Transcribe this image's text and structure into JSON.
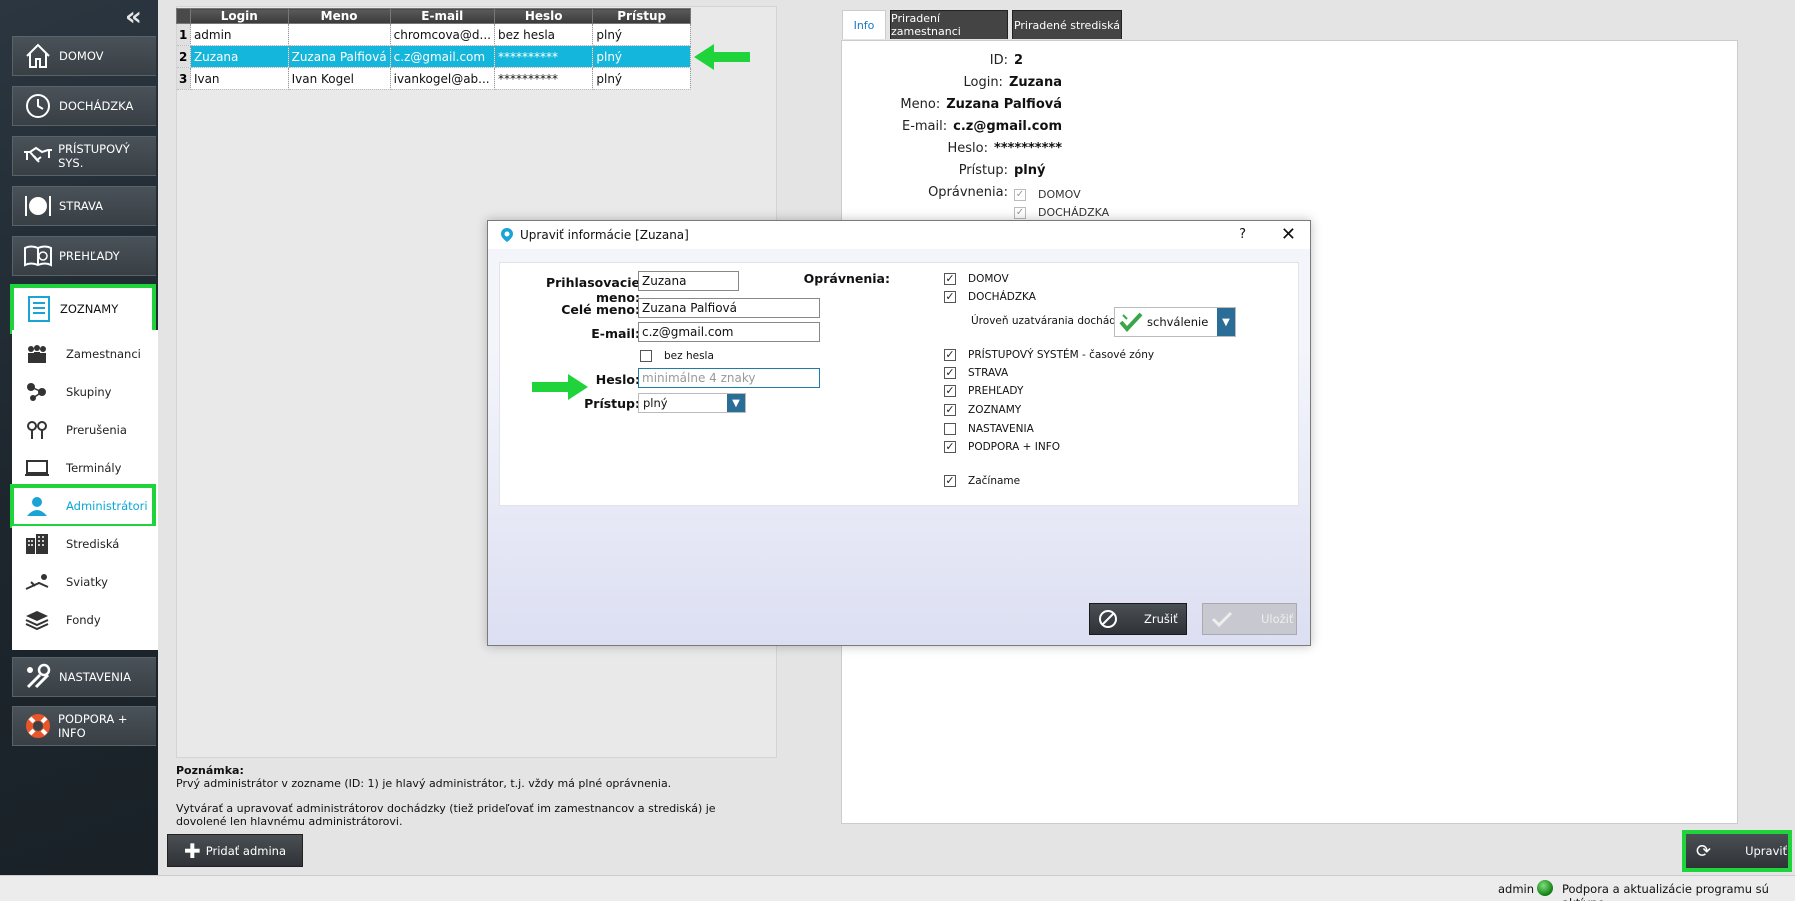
{
  "sidebar": {
    "collapse": "«",
    "main_top": [
      {
        "label": "DOMOV",
        "icon": "home-icon"
      },
      {
        "label": "DOCHÁDZKA",
        "icon": "clock-icon"
      },
      {
        "label": "PRÍSTUPOVÝ SYS.",
        "icon": "handshake-icon"
      },
      {
        "label": "STRAVA",
        "icon": "plate-icon"
      },
      {
        "label": "PREHĽADY",
        "icon": "book-icon"
      },
      {
        "label": "ZOZNAMY",
        "icon": "list-icon"
      }
    ],
    "sub": [
      {
        "label": "Zamestnanci",
        "icon": "people-icon"
      },
      {
        "label": "Skupiny",
        "icon": "groups-icon"
      },
      {
        "label": "Prerušenia",
        "icon": "pins-icon"
      },
      {
        "label": "Terminály",
        "icon": "terminal-icon"
      },
      {
        "label": "Administrátori",
        "icon": "admin-icon"
      },
      {
        "label": "Strediská",
        "icon": "building-icon"
      },
      {
        "label": "Sviatky",
        "icon": "holiday-icon"
      },
      {
        "label": "Fondy",
        "icon": "layers-icon"
      }
    ],
    "main_bottom": [
      {
        "label": "NASTAVENIA",
        "icon": "tools-icon"
      },
      {
        "label": "PODPORA + INFO",
        "icon": "lifebuoy-icon"
      }
    ]
  },
  "grid": {
    "headers": [
      "Login",
      "Meno",
      "E-mail",
      "Heslo",
      "Prístup"
    ],
    "rows": [
      {
        "idx": "1",
        "login": "admin",
        "meno": "",
        "email": "chromcova@d...",
        "heslo": "bez hesla",
        "pristup": "plný"
      },
      {
        "idx": "2",
        "login": "Zuzana",
        "meno": "Zuzana Palfiová",
        "email": "c.z@gmail.com",
        "heslo": "**********",
        "pristup": "plný"
      },
      {
        "idx": "3",
        "login": "Ivan",
        "meno": "Ivan Kogel",
        "email": "ivankogel@ab...",
        "heslo": "**********",
        "pristup": "plný"
      }
    ]
  },
  "note": {
    "title": "Poznámka:",
    "line1": "Prvý administrátor v zozname (ID: 1) je hlavý administrátor, t.j. vždy má plné oprávnenia.",
    "line2": "Vytvárať a upravovať administrátorov dochádzky (tiež prideľovať im zamestnancov a strediská) je dovolené len hlavnému administrátorovi."
  },
  "add_admin_label": "Pridať admina",
  "tabs": [
    "Info",
    "Priradení zamestnanci",
    "Priradené strediská"
  ],
  "detail": {
    "id_label": "ID:",
    "id": "2",
    "login_label": "Login:",
    "login": "Zuzana",
    "meno_label": "Meno:",
    "meno": "Zuzana Palfiová",
    "email_label": "E-mail:",
    "email": "c.z@gmail.com",
    "heslo_label": "Heslo:",
    "heslo": "**********",
    "pristup_label": "Prístup:",
    "pristup": "plný",
    "opravnenia_label": "Oprávnenia:",
    "perms": [
      "DOMOV",
      "DOCHÁDZKA"
    ]
  },
  "upravit_label": "Upraviť",
  "status": {
    "user": "admin",
    "message": "Podpora a aktualizácie programu sú aktívne"
  },
  "dialog": {
    "title": "Upraviť informácie [Zuzana]",
    "help": "?",
    "close": "✕",
    "login_label": "Prihlasovacie meno:",
    "login_value": "Zuzana",
    "name_label": "Celé meno:",
    "name_value": "Zuzana Palfiová",
    "email_label": "E-mail:",
    "email_value": "c.z@gmail.com",
    "no_password_label": "bez hesla",
    "password_label": "Heslo:",
    "password_placeholder": "minimálne 4 znaky",
    "access_label": "Prístup:",
    "access_value": "plný",
    "perms_label": "Oprávnenia:",
    "perms": [
      {
        "label": "DOMOV",
        "checked": true
      },
      {
        "label": "DOCHÁDZKA",
        "checked": true
      },
      {
        "label": "PRÍSTUPOVÝ SYSTÉM - časové zóny",
        "checked": true
      },
      {
        "label": "STRAVA",
        "checked": true
      },
      {
        "label": "PREHĽADY",
        "checked": true
      },
      {
        "label": "ZOZNAMY",
        "checked": true
      },
      {
        "label": "NASTAVENIA",
        "checked": false
      },
      {
        "label": "PODPORA + INFO",
        "checked": true
      },
      {
        "label": "Začíname",
        "checked": true
      }
    ],
    "closing_level_label": "Úroveň uzatvárania dochádzky",
    "closing_level_value": "schválenie",
    "cancel_label": "Zrušiť",
    "save_label": "Uložiť"
  },
  "colors": {
    "accent": "#14b6dc",
    "highlight": "#1fd43a",
    "sidebar": "#1d262d",
    "dropdown": "#2a6d96"
  }
}
